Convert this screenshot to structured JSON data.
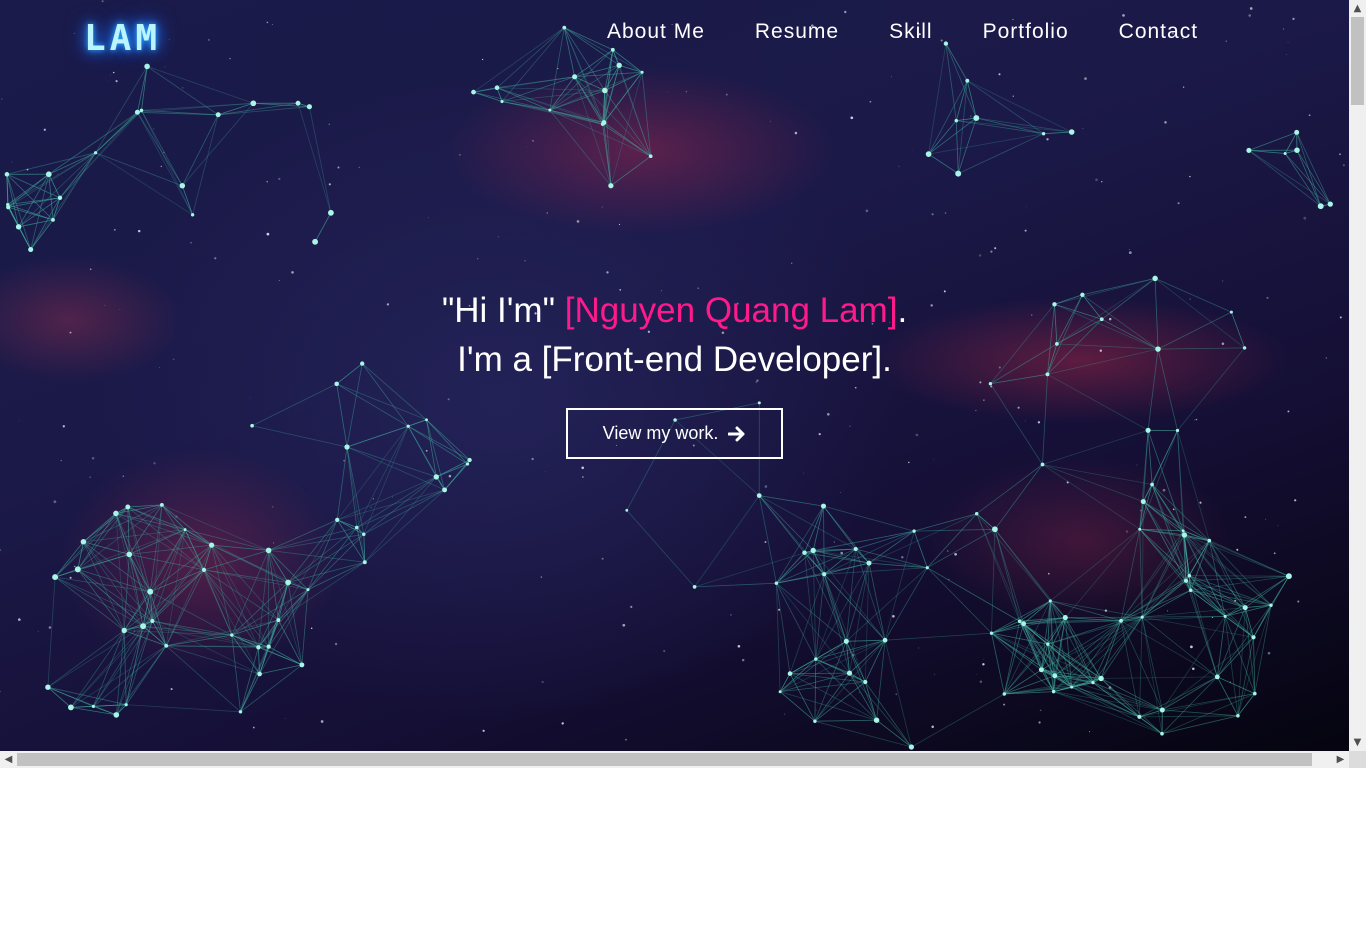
{
  "header": {
    "logo": "LAM",
    "nav": [
      {
        "label": "About Me"
      },
      {
        "label": "Resume"
      },
      {
        "label": "Skill"
      },
      {
        "label": "Portfolio"
      },
      {
        "label": "Contact"
      }
    ]
  },
  "hero": {
    "greeting_prefix": "\"Hi I'm\" ",
    "name": "[Nguyen Quang Lam]",
    "greeting_suffix": ".",
    "role_line": "I'm a [Front-end Developer].",
    "cta_label": "View my work."
  },
  "icons": {
    "cta_icon": "arrow-right-icon"
  },
  "colors": {
    "accent_pink": "#ff1a8c",
    "network_line": "#3fa89a",
    "network_node": "#a9f5e6",
    "logo_glow": "#2fa8ff"
  }
}
